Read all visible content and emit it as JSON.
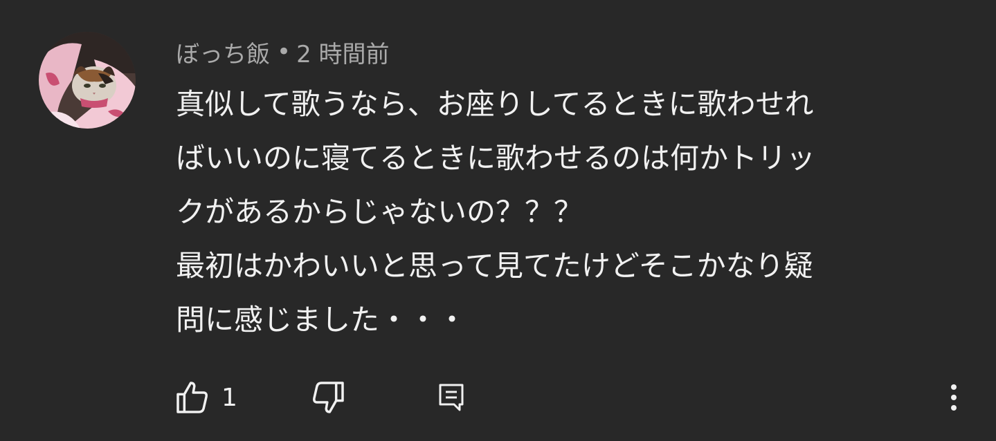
{
  "comment": {
    "author": "ぼっち飯",
    "separator": "•",
    "timestamp": "2 時間前",
    "avatar_icon": "cat-avatar-icon",
    "text_lines": [
      "真似して歌うなら、お座りしてるときに歌わせれ",
      "ばいいのに寝てるときに歌わせるのは何かトリッ",
      "クがあるからじゃないの？？？",
      "最初はかわいいと思って見てたけどそこかなり疑",
      "問に感じました・・・"
    ],
    "actions": {
      "like_icon": "thumbs-up-icon",
      "like_count": "1",
      "dislike_icon": "thumbs-down-icon",
      "reply_icon": "reply-icon",
      "more_icon": "more-vertical-icon"
    }
  },
  "colors": {
    "background": "#282828",
    "text": "#f1f1f1",
    "meta_text": "#aaaaaa"
  }
}
